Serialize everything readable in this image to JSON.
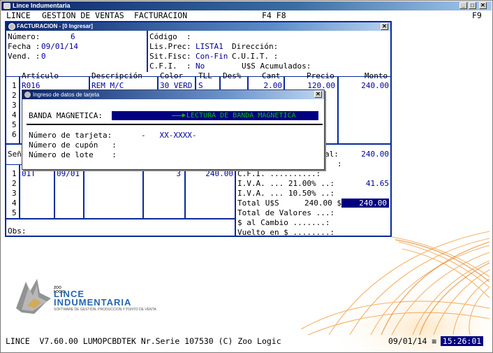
{
  "window": {
    "title": "Lince Indumentaria",
    "min": "_",
    "max": "□",
    "close": "✕"
  },
  "menu": {
    "lince": "LINCE",
    "gestion": "GESTION DE VENTAS",
    "facturacion": "FACTURACION",
    "keys": "F4 F8",
    "f9": "F9"
  },
  "factura": {
    "title": "FACTURACION - [0  Ingresar]",
    "numero_label": "Número:",
    "numero_value": "6",
    "fecha_label": "Fecha :",
    "fecha_value": "09/01/14",
    "vend_label": "Vend. :",
    "vend_value": "0",
    "codigo_label": "Código  :",
    "lisprec_label": "Lis.Prec:",
    "lisprec_value": "LISTA1",
    "direccion_label": "Dirección:",
    "sitfisc_label": "Sit.Fisc:",
    "sitfisc_value": "Con-Fin",
    "cuit_label": "C.U.I.T. :",
    "cfi_label": "C.F.I.  :",
    "cfi_value": "No",
    "uss_label": "U$S Acumulados:",
    "columns": {
      "articulo": "Artículo",
      "descripcion": "Descripción",
      "color": "Color",
      "tll": "TLL",
      "des": "Des%",
      "cant": "Cant",
      "precio": "Precio",
      "monto": "Monto"
    },
    "rows": [
      "1",
      "2",
      "3",
      "4",
      "5",
      "6"
    ],
    "item1": {
      "articulo": "R016",
      "descripcion": "REM M/C",
      "color": "30 VERD",
      "tll": "S",
      "cant": "2.00",
      "precio": "120.00",
      "monto": "240.00"
    },
    "sen_label": "Señ",
    "al_label": "al:",
    "subtotal_value": "240.00",
    "pay_rows": [
      "1",
      "2",
      "3",
      "4",
      "5"
    ],
    "pay1": {
      "c1": "01T",
      "c2": "09/01",
      "c3": "3",
      "c4": "240.00"
    },
    "dots_row": ":",
    "cfi_tot_label": "C.F.I. ..........:",
    "iva1_label": "I.V.A. ... 21.00% ..:",
    "iva1_value": "41.65",
    "iva2_label": "I.V.A. ... 10.50% ..:",
    "total_label": "Total U$S",
    "total_value_uss": "240.00 $",
    "total_value": "240.00",
    "totval_label": "Total de Valores ...:",
    "cambio_label": "$ al Cambio .......:",
    "vuelto_label": "Vuelto en $ ........:",
    "obs_label": "Obs:"
  },
  "tarjeta": {
    "title": "Ingreso de datos de tarjeta",
    "banda_label": "BANDA MAGNETICA:",
    "lectura": "LECTURA DE BANDA MAGNETICA",
    "num_tarjeta_label": "Número de tarjeta:",
    "num_tarjeta_value": "-   XX-XXXX-",
    "num_cupon_label": "Número de cupón   :",
    "num_lote_label": "Número de lote    :"
  },
  "logo": {
    "zoologic": "ZOO LOGIC",
    "line1": "LINCE",
    "line2": "INDUMENTARIA",
    "tagline": "SOFTWARE DE GESTION, PRODUCCION Y PUNTO DE VENTA"
  },
  "status": {
    "info": "LINCE  V7.60.00 LUMOPCBDTEK Nr.Serie 107530 (C) Zoo Logic",
    "date": "09/01/14 ≡",
    "time": "15:26:01"
  },
  "colors": {
    "frame": "#0a2a9a",
    "field_text": "#000099",
    "highlight": "#000080",
    "lectura": "#00c000",
    "swirl": "#f0a040"
  }
}
